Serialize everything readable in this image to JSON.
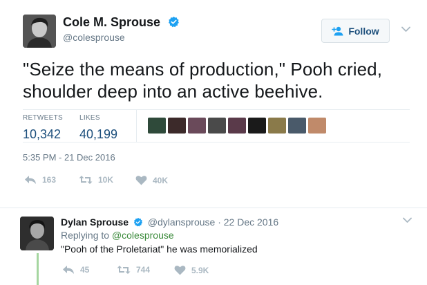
{
  "tweet": {
    "author_name": "Cole M. Sprouse",
    "author_handle": "@colesprouse",
    "follow_label": "Follow",
    "text": "\"Seize the means of production,\" Pooh cried, shoulder deep into an active beehive.",
    "stats": {
      "retweets_label": "RETWEETS",
      "retweets_value": "10,342",
      "likes_label": "LIKES",
      "likes_value": "40,199"
    },
    "timestamp": "5:35 PM - 21 Dec 2016",
    "actions": {
      "reply_count": "163",
      "retweet_count": "10K",
      "like_count": "40K"
    },
    "likers": [
      "#2f4a3a",
      "#3c2a2a",
      "#6a4a5a",
      "#4a4a4a",
      "#5a3a4a",
      "#1a1a1a",
      "#8a7a4a",
      "#4a5a6a",
      "#c08a6a"
    ]
  },
  "reply": {
    "author_name": "Dylan Sprouse",
    "author_handle": "@dylansprouse",
    "date": "· 22 Dec 2016",
    "replying_prefix": "Replying to",
    "replying_handle": "@colesprouse",
    "text": "\"Pooh of the Proletariat\" he was memorialized",
    "actions": {
      "reply_count": "45",
      "retweet_count": "744",
      "like_count": "5.9K"
    }
  },
  "colors": {
    "verified": "#1da1f2",
    "link_blue": "#1c4f7c",
    "muted": "#657786",
    "icon_gray": "#aab8c2",
    "thread_line": "#a5d6a0"
  }
}
